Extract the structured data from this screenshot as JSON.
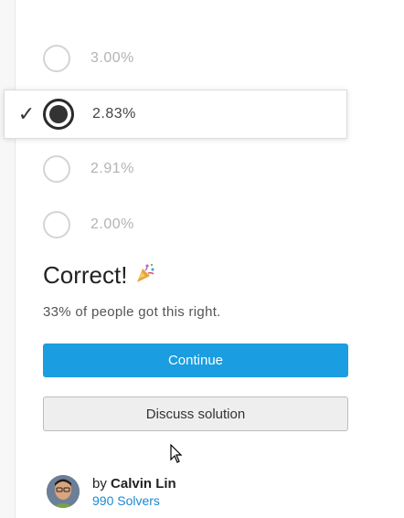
{
  "options": [
    {
      "label": "3.00%",
      "selected": false
    },
    {
      "label": "2.83%",
      "selected": true
    },
    {
      "label": "2.91%",
      "selected": false
    },
    {
      "label": "2.00%",
      "selected": false
    }
  ],
  "result": {
    "title": "Correct!",
    "stat": "33% of people got this right."
  },
  "buttons": {
    "continue": "Continue",
    "discuss": "Discuss solution"
  },
  "author": {
    "by": "by",
    "name": "Calvin Lin",
    "solvers": "990 Solvers"
  },
  "colors": {
    "accent": "#1a9de1",
    "link": "#1a8ad0"
  },
  "icons": {
    "check": "check-icon",
    "celebration": "party-popper-icon",
    "cursor": "mouse-pointer-icon"
  }
}
